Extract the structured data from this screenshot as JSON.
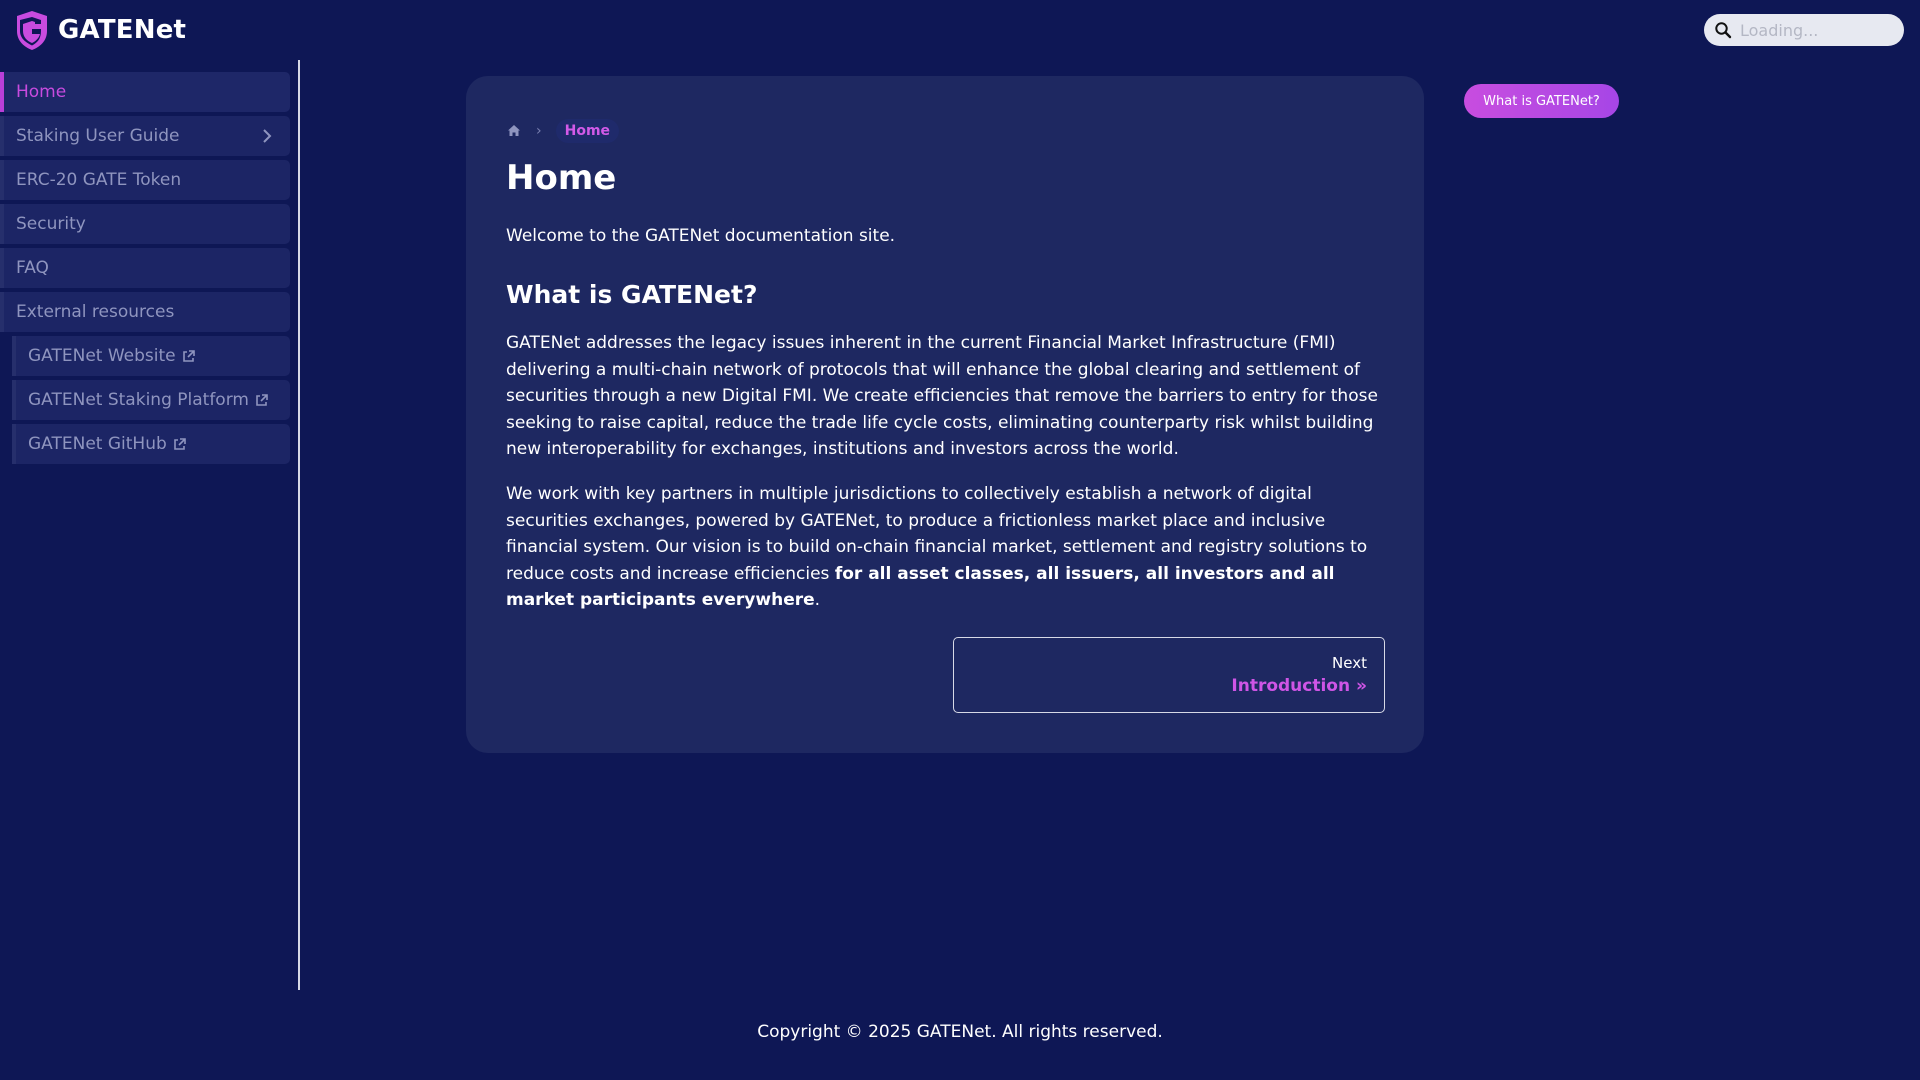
{
  "navbar": {
    "brand_title": "GATENet",
    "search_placeholder": "Loading..."
  },
  "sidebar": {
    "items": [
      {
        "label": "Home",
        "active": true
      },
      {
        "label": "Staking User Guide",
        "expandable": true
      },
      {
        "label": "ERC-20 GATE Token"
      },
      {
        "label": "Security"
      },
      {
        "label": "FAQ"
      },
      {
        "label": "External resources"
      },
      {
        "label": "GATENet Website",
        "external": true
      },
      {
        "label": "GATENet Staking Platform",
        "external": true
      },
      {
        "label": "GATENet GitHub",
        "external": true
      }
    ]
  },
  "breadcrumb": {
    "current": "Home"
  },
  "main": {
    "title": "Home",
    "intro": "Welcome to the GATENet documentation site.",
    "section_title": "What is GATENet?",
    "para1": "GATENet addresses the legacy issues inherent in the current Financial Market Infrastructure (FMI) delivering a multi-chain network of protocols that will enhance the global clearing and settlement of securities through a new Digital FMI. We create efficiencies that remove the barriers to entry for those seeking to raise capital, reduce the trade life cycle costs, eliminating counterparty risk whilst building new interoperability for exchanges, institutions and investors across the world.",
    "para2_start": "We work with key partners in multiple jurisdictions to collectively establish a network of digital securities exchanges, powered by GATENet, to produce a frictionless market place and inclusive financial system. Our vision is to build on-chain financial market, settlement and registry solutions to reduce costs and increase efficiencies ",
    "para2_bold": "for all asset classes, all issuers, all investors and all market participants everywhere",
    "para2_end": "."
  },
  "pagination": {
    "next_sub": "Next",
    "next_label": "Introduction »"
  },
  "toc": {
    "label": "What is GATENet?"
  },
  "footer": {
    "text": "Copyright © 2025 GATENet. All rights reserved."
  },
  "colors": {
    "background": "#0e1755",
    "card": "#1e2861",
    "accent": "#c84bdf",
    "sidebar_item": "#1c2565"
  }
}
